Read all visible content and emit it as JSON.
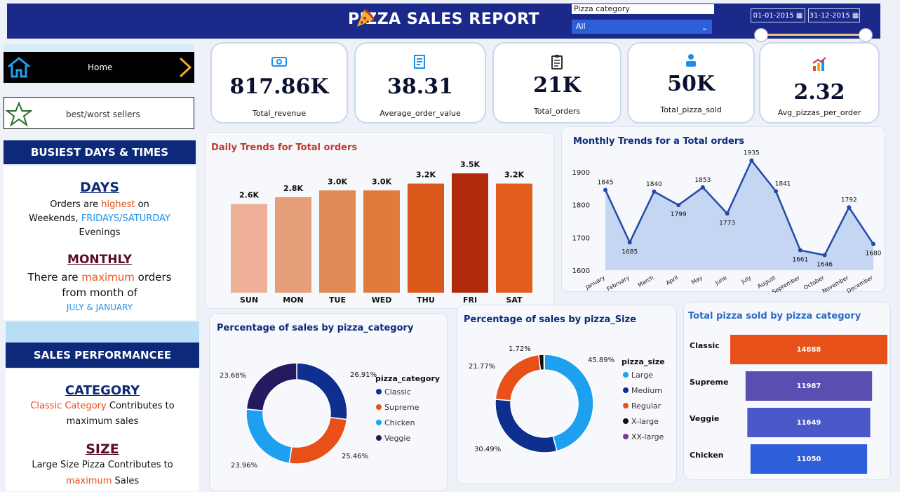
{
  "header": {
    "title": "PIZZA SALES REPORT",
    "slicer_label": "Pizza category",
    "slicer_value": "All",
    "date_start": "01-01-2015",
    "date_end": "31-12-2015"
  },
  "nav": {
    "home": "Home",
    "best_worst": "best/worst sellers"
  },
  "left": {
    "busiest_title": "BUSIEST DAYS & TIMES",
    "days_title": "DAYS",
    "days_line1a": "Orders are ",
    "days_line1b": "highest",
    "days_line1c": " on",
    "days_line2a": "Weekends, ",
    "days_line2b": "FRIDAYS/SATURDAY",
    "days_line3": "Evenings",
    "monthly_title": "MONTHLY",
    "monthly_line1a": "There are ",
    "monthly_line1b": "maximum",
    "monthly_line1c": " orders",
    "monthly_line2": "from month of",
    "monthly_line3": "JULY & JANUARY",
    "sales_title": "SALES PERFORMANCEE",
    "category_title": "CATEGORY",
    "category_line1a": "Classic Category",
    "category_line1b": " Contributes to",
    "category_line2": "maximum sales",
    "size_title": "SIZE",
    "size_line1": "Large Size Pizza Contributes to",
    "size_line2a": "maximum",
    "size_line2b": " Sales"
  },
  "kpis": [
    {
      "value": "817.86K",
      "label": "Total_revenue"
    },
    {
      "value": "38.31",
      "label": "Average_order_value"
    },
    {
      "value": "21K",
      "label": "Total_orders"
    },
    {
      "value": "50K",
      "label": "Total_pizza_sold"
    },
    {
      "value": "2.32",
      "label": "Avg_pizzas_per_order"
    }
  ],
  "colors": {
    "navy": "#1b2a8a",
    "classic": "#0f2f8f",
    "supreme": "#e8501a",
    "chicken": "#1ea0f0",
    "veggie": "#241a5e"
  },
  "chart_data": [
    {
      "type": "bar",
      "title": "Daily Trends for Total orders",
      "categories": [
        "SUN",
        "MON",
        "TUE",
        "WED",
        "THU",
        "FRI",
        "SAT"
      ],
      "values": [
        2.6,
        2.8,
        3.0,
        3.0,
        3.2,
        3.5,
        3.2
      ],
      "labels": [
        "2.6K",
        "2.8K",
        "3.0K",
        "3.0K",
        "3.2K",
        "3.5K",
        "3.2K"
      ],
      "colors": [
        "#eeb197",
        "#e59e77",
        "#e28a55",
        "#e27a3c",
        "#d9581a",
        "#b22a0c",
        "#e05d1c"
      ]
    },
    {
      "type": "line",
      "title": "Monthly Trends for a Total orders",
      "x": [
        "January",
        "February",
        "March",
        "April",
        "May",
        "June",
        "July",
        "August",
        "September",
        "October",
        "November",
        "December"
      ],
      "values": [
        1845,
        1685,
        1840,
        1799,
        1853,
        1773,
        1935,
        1841,
        1661,
        1646,
        1792,
        1680
      ],
      "yticks": [
        "1600",
        "1700",
        "1800",
        "1900"
      ],
      "ylim": [
        1600,
        1900
      ]
    },
    {
      "type": "pie",
      "title": "Percentage of sales by pizza_category",
      "legend_title": "pizza_category",
      "slices": [
        {
          "name": "Classic",
          "value": 26.91,
          "label": "26.91%"
        },
        {
          "name": "Supreme",
          "value": 25.46,
          "label": "25.46%"
        },
        {
          "name": "Chicken",
          "value": 23.96,
          "label": "23.96%"
        },
        {
          "name": "Veggie",
          "value": 23.68,
          "label": "23.68%"
        }
      ]
    },
    {
      "type": "pie",
      "title": "Percentage of sales by pizza_Size",
      "legend_title": "pizza_size",
      "slices": [
        {
          "name": "Large",
          "value": 45.89,
          "label": "45.89%",
          "color": "#1ea0f0"
        },
        {
          "name": "Medium",
          "value": 30.49,
          "label": "30.49%",
          "color": "#0f2f8f"
        },
        {
          "name": "Regular",
          "value": 21.77,
          "label": "21.77%",
          "color": "#e8501a"
        },
        {
          "name": "X-large",
          "value": 1.72,
          "label": "1.72%",
          "color": "#111111"
        },
        {
          "name": "XX-large",
          "value": 0.12,
          "label": "",
          "color": "#7a3a9a"
        }
      ]
    },
    {
      "type": "bar",
      "title": "Total pizza sold by pizza category",
      "categories": [
        "Classic",
        "Supreme",
        "Veggie",
        "Chicken"
      ],
      "values": [
        14888,
        11987,
        11649,
        11050
      ],
      "colors": [
        "#e8501a",
        "#5a4fb0",
        "#4a58c8",
        "#2f5fd8"
      ]
    }
  ]
}
